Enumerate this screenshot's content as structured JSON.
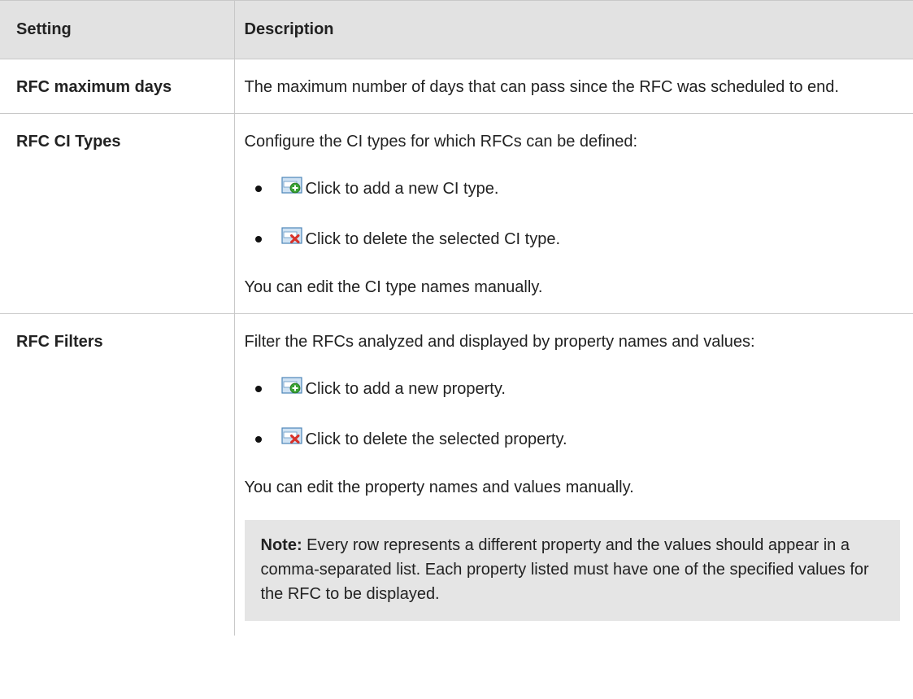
{
  "table": {
    "headers": [
      "Setting",
      "Description"
    ],
    "rows": [
      {
        "setting": "RFC maximum days",
        "intro": "The maximum number of days that can pass since the RFC was scheduled to end."
      },
      {
        "setting": "RFC CI Types",
        "intro": "Configure the CI types for which RFCs can be defined:",
        "bullets": [
          {
            "icon": "add-row-icon",
            "text": "Click to add a new CI type."
          },
          {
            "icon": "delete-row-icon",
            "text": "Click to delete the selected CI type."
          }
        ],
        "outro": "You can edit the CI type names manually."
      },
      {
        "setting": "RFC Filters",
        "intro": "Filter the RFCs analyzed and displayed by property names and values:",
        "bullets": [
          {
            "icon": "add-row-icon",
            "text": "Click to add a new property."
          },
          {
            "icon": "delete-row-icon",
            "text": "Click to delete the selected property."
          }
        ],
        "outro": "You can edit the property names and values manually.",
        "note": {
          "label": "Note:",
          "text": "Every row represents a different property and the values should appear in a comma-separated list. Each property listed must have one of the specified values for the RFC to be displayed."
        }
      }
    ]
  },
  "colors": {
    "header_bg": "#e2e2e2",
    "note_bg": "#e5e5e5",
    "border": "#c8c8c8",
    "add_icon_accent": "#3aa335",
    "delete_icon_accent": "#d8322a"
  }
}
